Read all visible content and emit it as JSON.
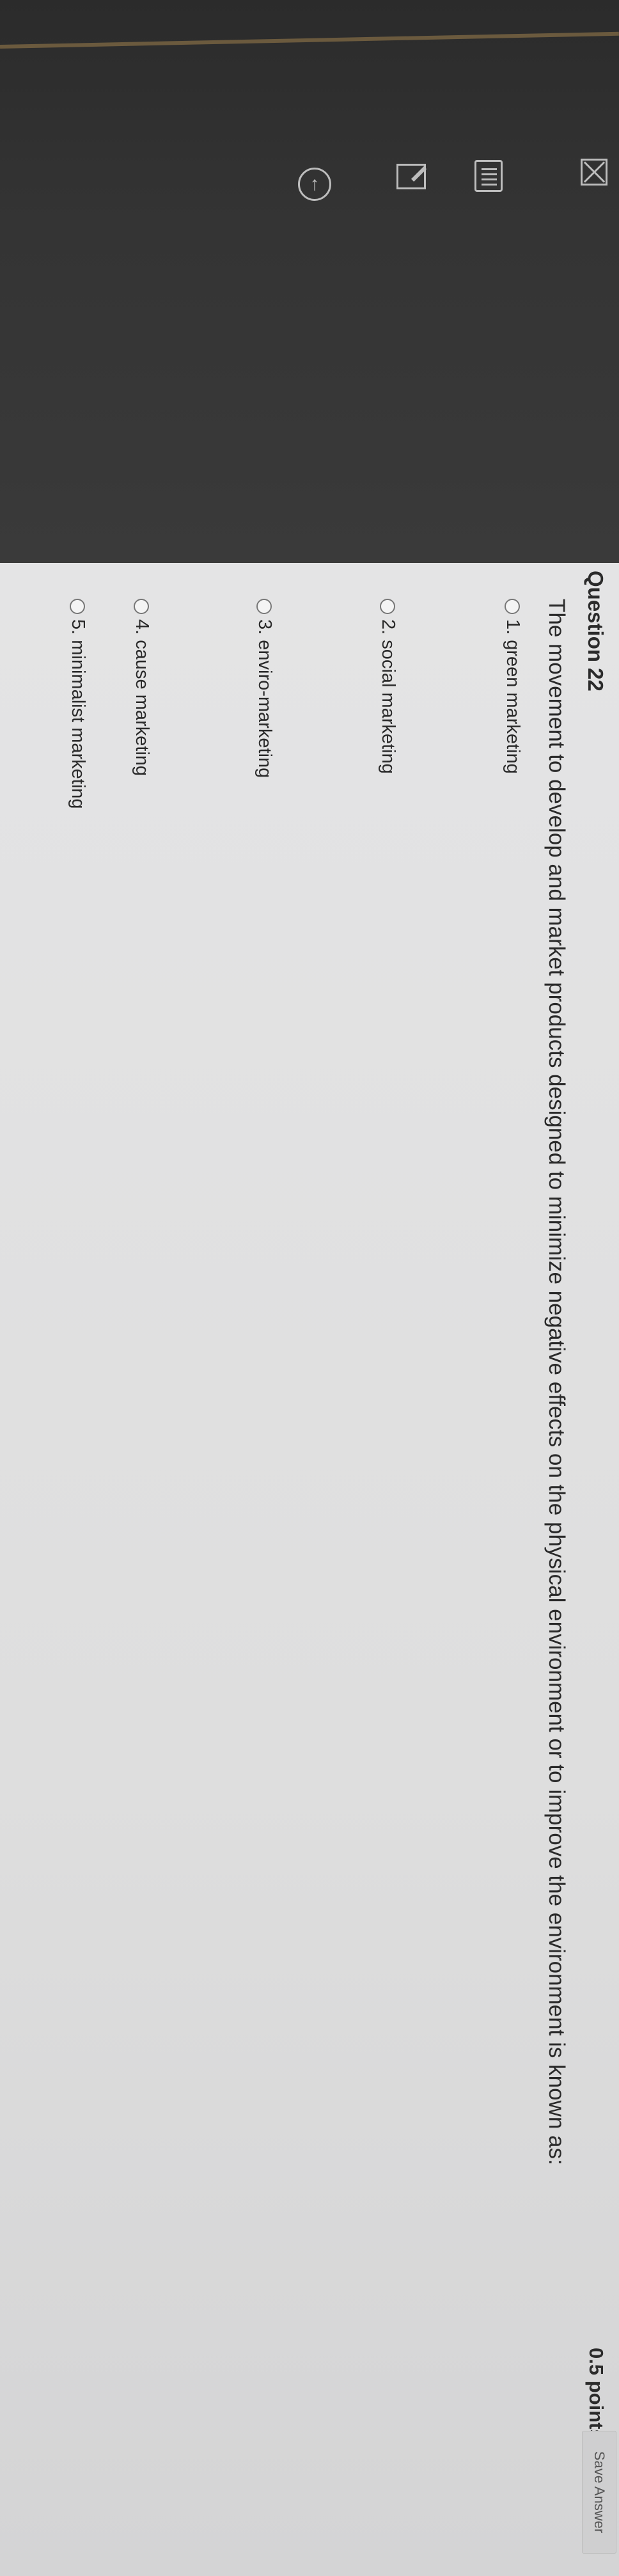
{
  "toolbar": {
    "icons": [
      "close-icon",
      "list-icon",
      "edit-icon",
      "upload-icon"
    ]
  },
  "question": {
    "title": "Question 22",
    "points": "0.5 points",
    "save_label": "Save Answer",
    "text": "The movement to develop and market products designed to minimize negative effects on the physical environment or to improve the environment is known as:",
    "options": [
      {
        "label": "1. green marketing"
      },
      {
        "label": "2. social marketing"
      },
      {
        "label": "3. enviro-marketing"
      },
      {
        "label": "4. cause marketing"
      },
      {
        "label": "5. minimalist marketing"
      }
    ]
  },
  "colors": {
    "dark_background": "#333333",
    "page_background": "#e0e0e1",
    "text": "#2a2a2a",
    "button": "#cfcfd0"
  }
}
